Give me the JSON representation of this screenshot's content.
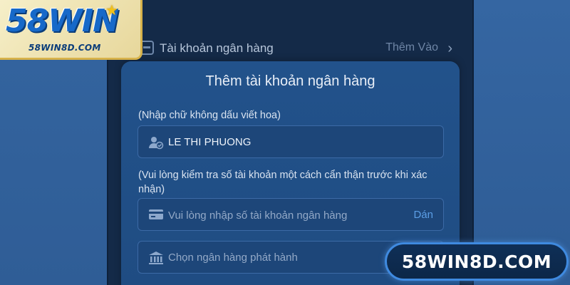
{
  "branding": {
    "logo_text": "58WIN",
    "logo_subtext": "58WIN8D.COM",
    "domain_badge": "58WIN8D.COM"
  },
  "background_row": {
    "label": "Tài khoản ngân hàng",
    "action": "Thêm Vào"
  },
  "modal": {
    "title": "Thêm tài khoản ngân hàng",
    "name_hint": "(Nhập chữ không dấu viết hoa)",
    "name_value": "LE THI PHUONG",
    "account_hint": "(Vui lòng kiểm tra số tài khoản một cách cẩn thận trước khi xác nhận)",
    "account_placeholder": "Vui lòng nhập số tài khoản ngân hàng",
    "paste_label": "Dán",
    "bank_select_placeholder": "Chọn ngân hàng phát hành"
  },
  "colors": {
    "modal_bg": "#22528b",
    "accent": "#5b9ee6",
    "logo_blue": "#1769c9",
    "logo_gold": "#f2c21b"
  },
  "icons": [
    "user-check-icon",
    "card-icon",
    "bank-icon",
    "chevron-right-icon",
    "star-icon"
  ]
}
